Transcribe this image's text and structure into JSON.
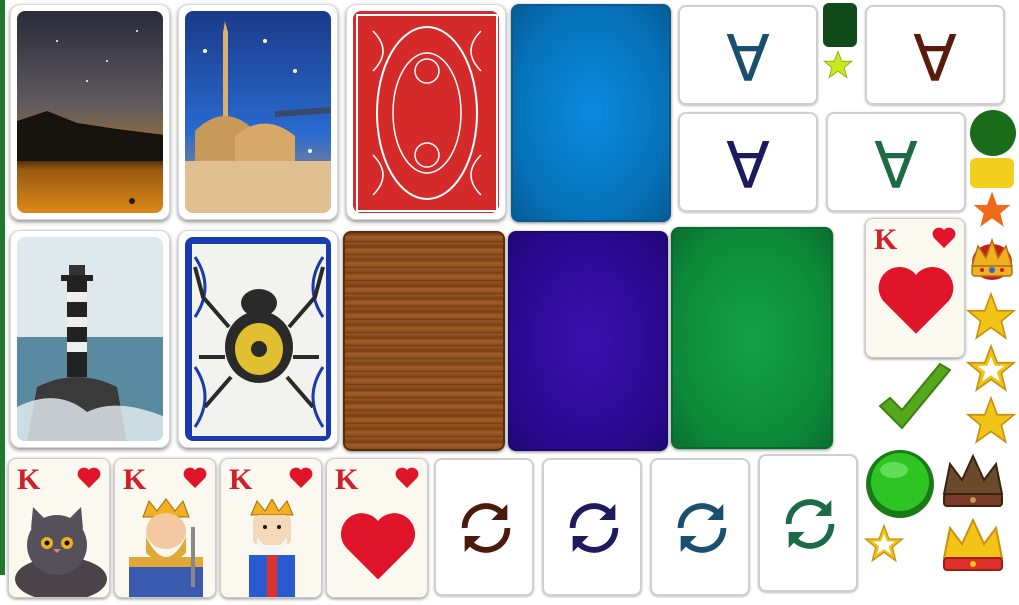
{
  "backgrounds": {
    "photos": [
      {
        "name": "night-sky-desert"
      },
      {
        "name": "mosque-winter-night"
      },
      {
        "name": "lighthouse-sea"
      }
    ],
    "card_backs": [
      {
        "name": "red-ornate-back"
      },
      {
        "name": "blue-spider-back"
      }
    ],
    "table_colors": [
      {
        "name": "blue-felt",
        "color": "#0b7fc8"
      },
      {
        "name": "wood",
        "color": "#8a4b1c"
      },
      {
        "name": "purple-felt",
        "color": "#3a0fa0"
      },
      {
        "name": "green-felt",
        "color": "#0f8a3c"
      }
    ]
  },
  "aces": [
    {
      "letter": "A",
      "color": "#1b4f6e"
    },
    {
      "letter": "A",
      "color": "#5a1a0c"
    },
    {
      "letter": "A",
      "color": "#1e1a5e"
    },
    {
      "letter": "A",
      "color": "#1d6b45"
    }
  ],
  "kings": [
    {
      "letter": "K",
      "suit": "♥",
      "style": "cat"
    },
    {
      "letter": "K",
      "suit": "♥",
      "style": "classic"
    },
    {
      "letter": "K",
      "suit": "♥",
      "style": "cartoon"
    },
    {
      "letter": "K",
      "suit": "♥",
      "style": "minimal"
    },
    {
      "letter": "K",
      "suit": "♥",
      "style": "big-heart"
    }
  ],
  "refresh_colors": [
    "#4a1a0a",
    "#1e1a5e",
    "#1b4f6e",
    "#1d6b45"
  ],
  "icons": {
    "dark_square": "#0f4a18",
    "green_circle": "#1a6b1a",
    "yellow_rect": "#f2cf1e",
    "orange_star": "#f06a1a",
    "checkmark": "#55a81e",
    "green_button": "#25b51e"
  }
}
